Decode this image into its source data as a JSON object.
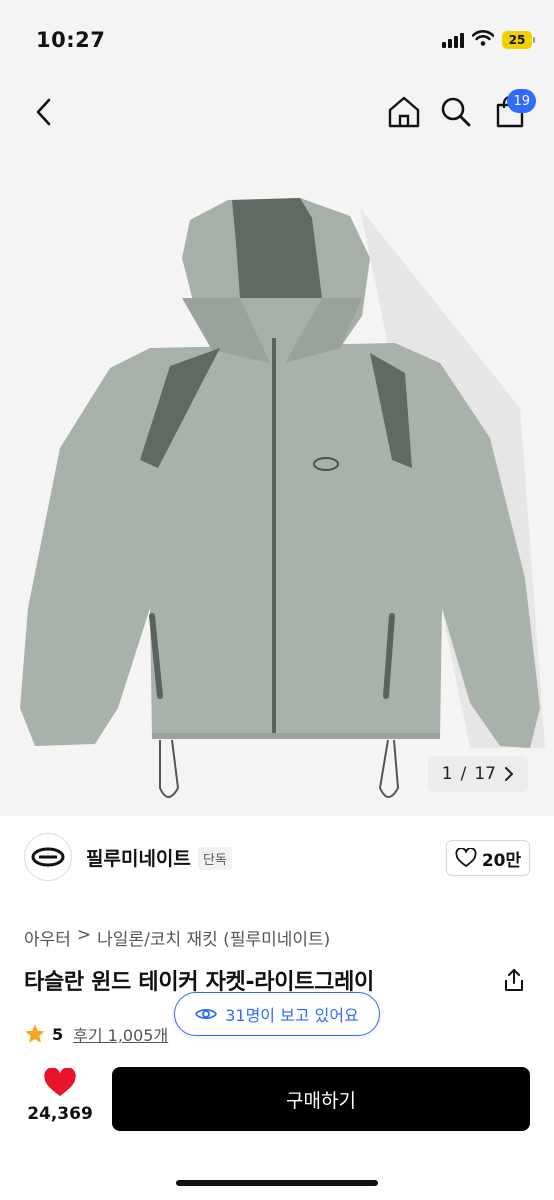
{
  "status": {
    "time": "10:27",
    "battery": "25"
  },
  "header": {
    "cart_count": "19"
  },
  "gallery": {
    "current": "1",
    "total": "17",
    "counter_sep": "/"
  },
  "brand": {
    "name": "필루미네이트",
    "tag": "단독",
    "likes": "20만"
  },
  "breadcrumb": {
    "items": [
      "아우터",
      "나일론/코치 재킷 (필루미네이트)"
    ],
    "separator": ">"
  },
  "product": {
    "title": "타슬란 윈드 테이커 자켓-라이트그레이"
  },
  "viewing": {
    "text": "31명이 보고 있어요"
  },
  "rating": {
    "score": "5",
    "review_text": "후기 1,005개"
  },
  "bottom": {
    "like_count": "24,369",
    "buy_label": "구매하기"
  },
  "colors": {
    "accent": "#2f6bff",
    "heart": "#e8142b",
    "star": "#f5a623",
    "jacket": "#a9b1ab",
    "panel": "#5f6a62"
  }
}
